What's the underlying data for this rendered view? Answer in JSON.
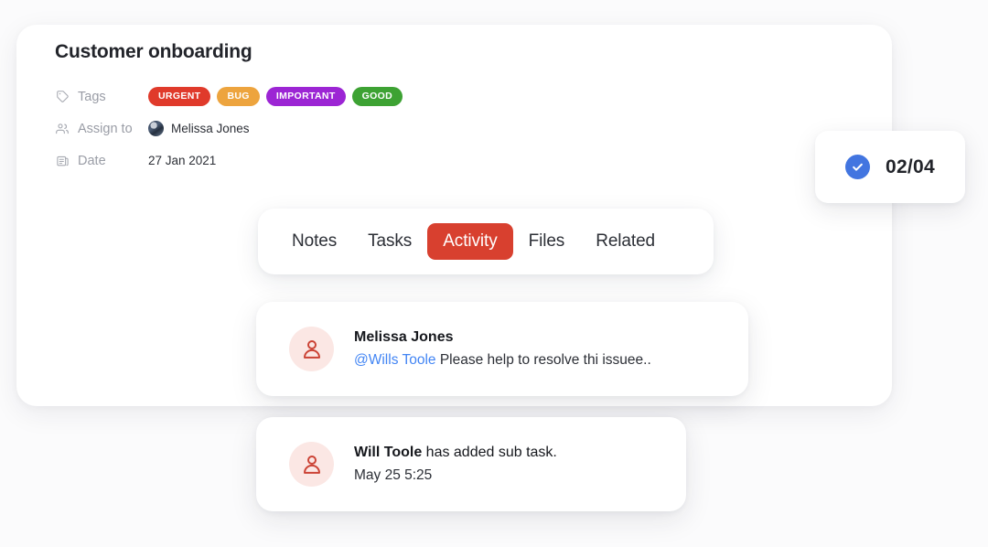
{
  "theme": {
    "background": "#fbfbfc",
    "card_background": "#ffffff",
    "accent_red": "#d8402f",
    "accent_blue": "#4275e0",
    "mention_blue": "#4285f4",
    "muted_text": "#9a9da6",
    "primary_text": "#22242a",
    "avatar_bg": "#fbe7e4",
    "avatar_icon": "#cb4234"
  },
  "header": {
    "title": "Customer onboarding"
  },
  "meta": {
    "rows": [
      {
        "key": "Tags",
        "icon": "tag-icon"
      },
      {
        "key": "Assign to",
        "icon": "people-icon"
      },
      {
        "key": "Date",
        "icon": "calendar-icon"
      }
    ],
    "tags": [
      {
        "label": "URGENT",
        "color": "#e03a2b"
      },
      {
        "label": "BUG",
        "color": "#eda43e"
      },
      {
        "label": "IMPORTANT",
        "color": "#9c25d4"
      },
      {
        "label": "GOOD",
        "color": "#3da233"
      }
    ],
    "assignee": {
      "name": "Melissa Jones",
      "avatar": "photo-avatar"
    },
    "date": {
      "value": "27 Jan 2021"
    }
  },
  "progress": {
    "icon": "check-circle-icon",
    "value": "02/04"
  },
  "tabs": [
    {
      "label": "Notes",
      "active": false
    },
    {
      "label": "Tasks",
      "active": false
    },
    {
      "label": "Activity",
      "active": true
    },
    {
      "label": "Files",
      "active": false
    },
    {
      "label": "Related",
      "active": false
    }
  ],
  "activity": [
    {
      "avatar": "person-icon",
      "line1_strong": "Melissa Jones",
      "line1_normal": "",
      "line2_mention": "@Wills Toole",
      "line2_text": " Please help to resolve thi issuee.."
    },
    {
      "avatar": "person-icon",
      "line1_strong": "Will Toole",
      "line1_normal": " has added sub task.",
      "line2_mention": "",
      "line2_text": "May 25 5:25"
    }
  ]
}
